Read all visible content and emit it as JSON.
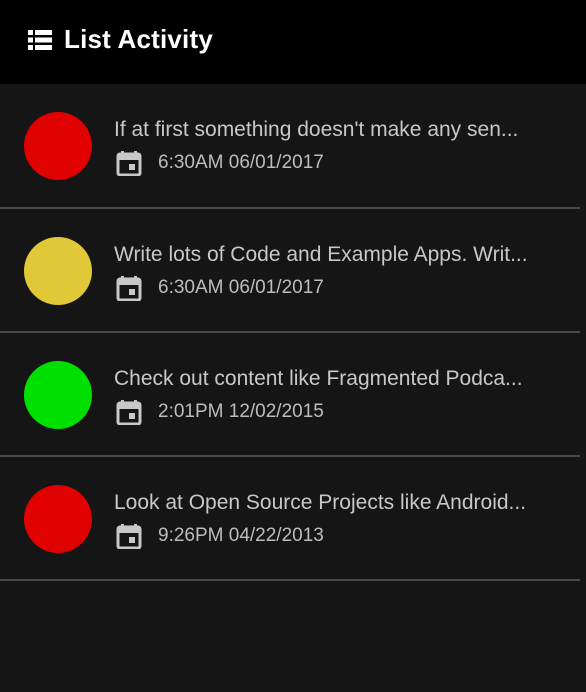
{
  "toolbar": {
    "icon": "view-list-icon",
    "title": "List Activity"
  },
  "items": [
    {
      "color": "#e00000",
      "text": "If at first something doesn't make any sen...",
      "datetime": "6:30AM 06/01/2017"
    },
    {
      "color": "#e0c838",
      "text": "Write lots of Code and Example Apps. Writ...",
      "datetime": "6:30AM 06/01/2017"
    },
    {
      "color": "#00e000",
      "text": "Check out content like Fragmented Podca...",
      "datetime": "2:01PM 12/02/2015"
    },
    {
      "color": "#e00000",
      "text": "Look at Open Source Projects like Android...",
      "datetime": "9:26PM 04/22/2013"
    }
  ]
}
